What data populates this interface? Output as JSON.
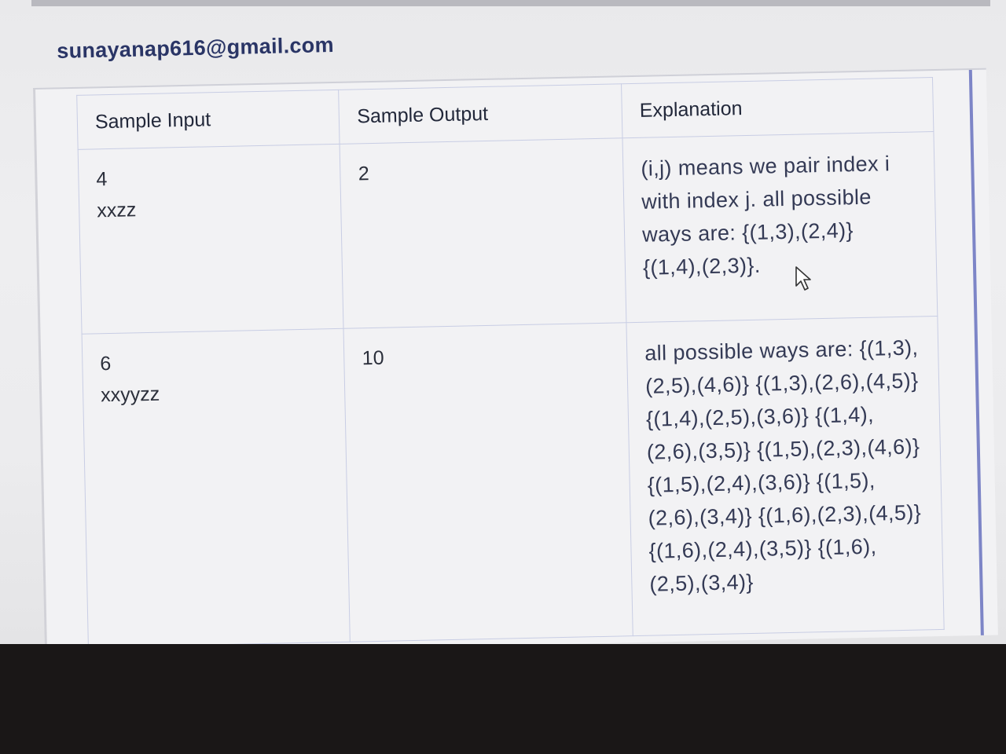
{
  "account": {
    "email": "sunayanap616@gmail.com"
  },
  "table": {
    "headers": [
      "Sample Input",
      "Sample Output",
      "Explanation"
    ],
    "rows": [
      {
        "input": [
          "4",
          "xxzz"
        ],
        "output": "2",
        "explanation": "(i,j) means we pair index i with index j. all possible ways are: {(1,3),(2,4)} {(1,4),(2,3)}."
      },
      {
        "input": [
          "6",
          "xxyyzz"
        ],
        "output": "10",
        "explanation": "all possible ways are: {(1,3),(2,5),(4,6)} {(1,3),(2,6),(4,5)} {(1,4),(2,5),(3,6)} {(1,4),(2,6),(3,5)} {(1,5),(2,3),(4,6)} {(1,5),(2,4),(3,6)} {(1,5),(2,6),(3,4)} {(1,6),(2,3),(4,5)} {(1,6),(2,4),(3,5)} {(1,6),(2,5),(3,4)}"
      }
    ]
  },
  "icons": {
    "cursor": "mouse-pointer-icon"
  },
  "colors": {
    "email_text": "#2a3566",
    "table_border": "#c8cde4",
    "scrollbar": "#7d85c7"
  }
}
